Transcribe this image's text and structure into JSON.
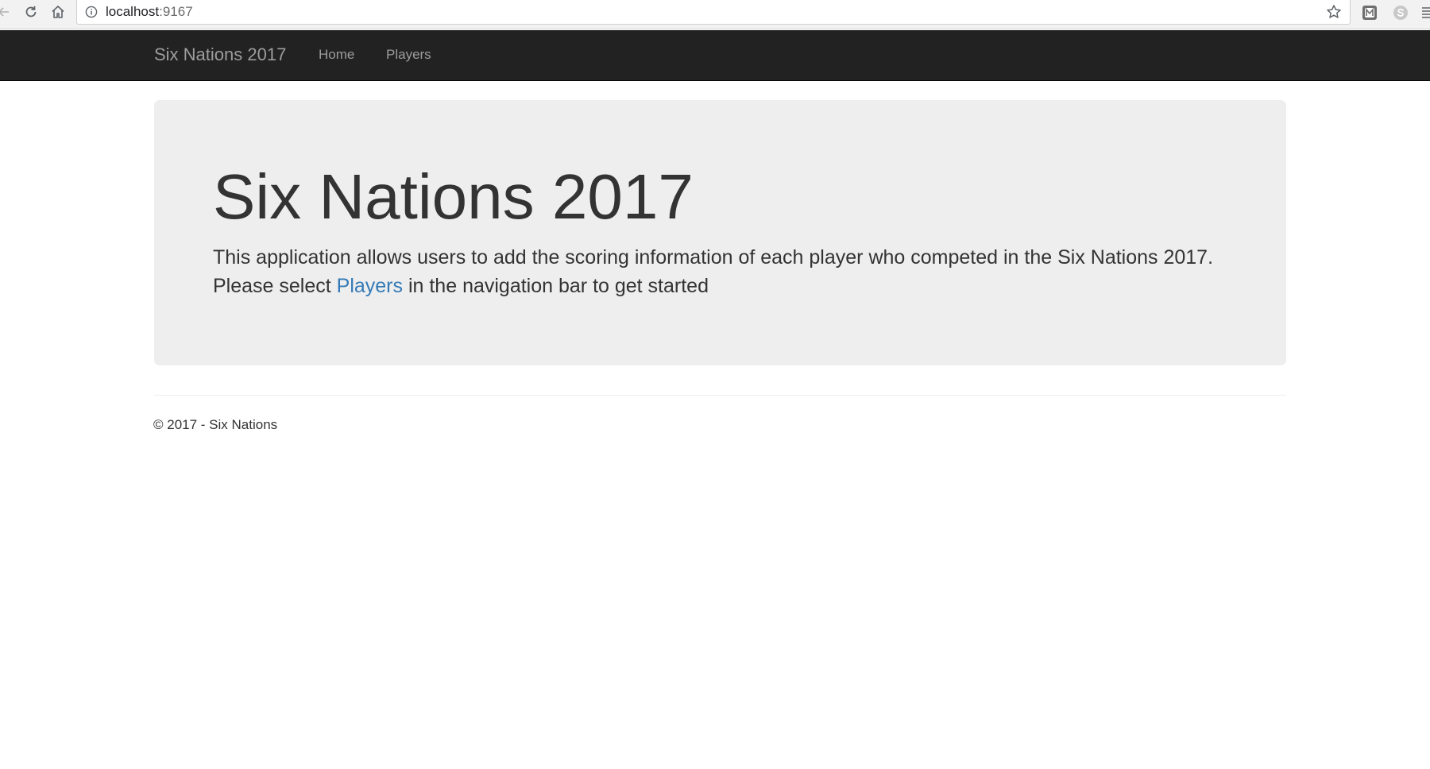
{
  "browser": {
    "url_host": "localhost",
    "url_port": ":9167",
    "icons": {
      "back": "arrow-back-icon",
      "reload": "reload-icon",
      "home": "home-icon",
      "info": "info-icon",
      "bookmark": "star-icon",
      "extension_1": "extension-icon",
      "extension_2": "skype-icon",
      "menu": "menu-icon"
    }
  },
  "navbar": {
    "brand": "Six Nations 2017",
    "links": [
      {
        "label": "Home"
      },
      {
        "label": "Players"
      }
    ],
    "colors": {
      "background": "#222222",
      "link": "#9d9d9d"
    }
  },
  "jumbotron": {
    "title": "Six Nations 2017",
    "lead_before": "This application allows users to add the scoring information of each player who competed in the Six Nations 2017. Please select ",
    "lead_link": "Players",
    "lead_after": " in the navigation bar to get started",
    "colors": {
      "background": "#eeeeee",
      "link": "#337ab7"
    }
  },
  "footer": {
    "text": "© 2017 - Six Nations"
  }
}
